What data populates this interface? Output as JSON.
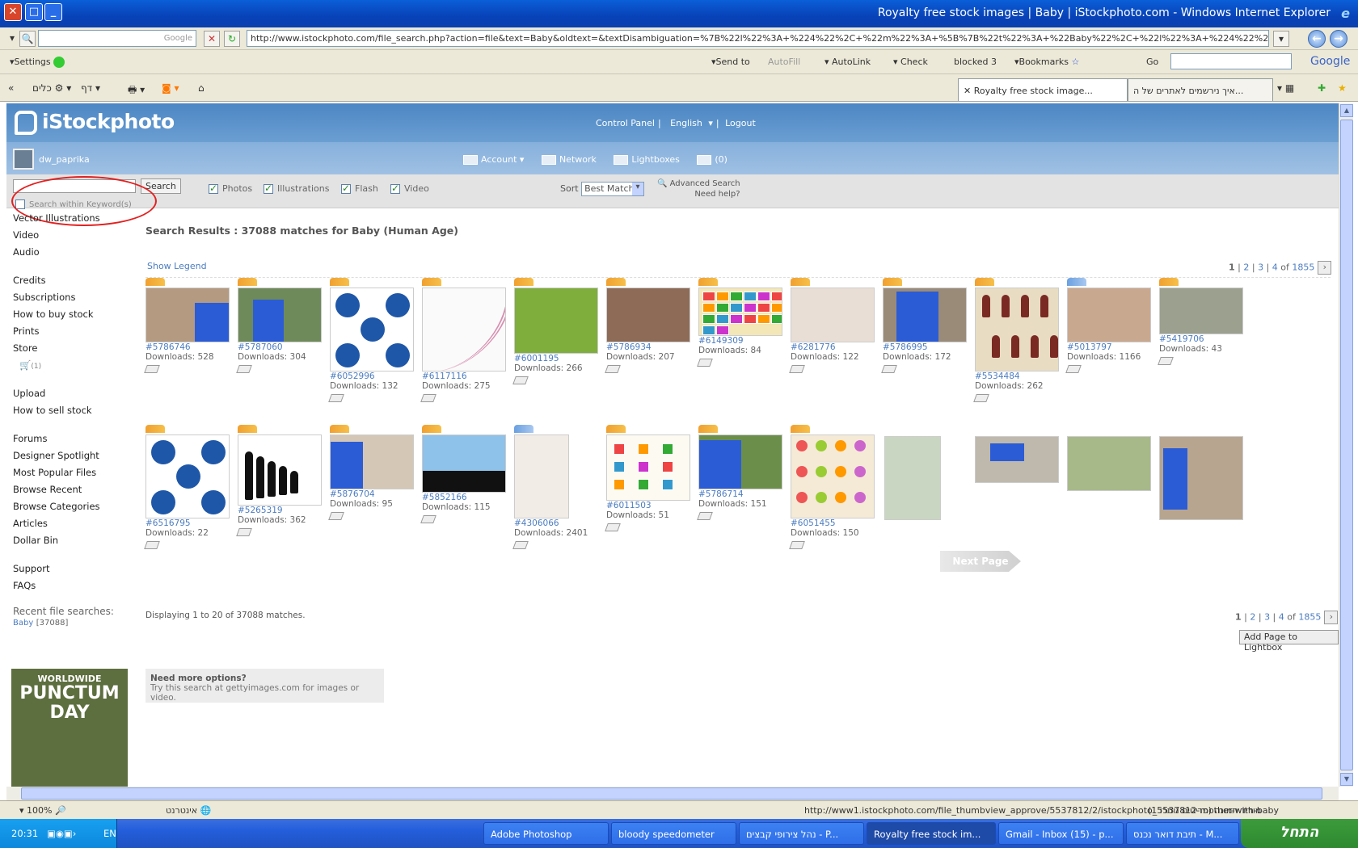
{
  "window": {
    "title": "Royalty free stock images | Baby | iStockphoto.com - Windows Internet Explorer"
  },
  "address": {
    "search_placeholder": "Google",
    "url": "http://www.istockphoto.com/file_search.php?action=file&text=Baby&oldtext=&textDisambiguation=%7B%22l%22%3A+%224%22%2C+%22m%22%3A+%5B%7B%22t%22%3A+%22Baby%22%2C+%22l%22%3A+%224%22%2C+%22c%22%3A+%"
  },
  "toolbar": {
    "settings": "Settings",
    "send_to": "Send to",
    "autofill": "AutoFill",
    "autolink": "AutoLink",
    "check": "Check",
    "blocked": "blocked 3",
    "bookmarks": "Bookmarks",
    "go": "Go",
    "google": "Google"
  },
  "tabs_row": {
    "tools": "כלים",
    "page": "דף",
    "tabs": [
      {
        "label": "Royalty free stock image...",
        "active": true
      },
      {
        "label": "איך נירשמים לאתרים של ה...",
        "active": false
      }
    ]
  },
  "site": {
    "logo": "iStockphoto",
    "header_links": [
      "Control Panel",
      "English",
      "Logout"
    ],
    "username": "dw_paprika",
    "user_links": {
      "account": "Account",
      "network": "Network",
      "lightboxes": "Lightboxes",
      "messages": "(0)"
    },
    "search_button": "Search",
    "filters": [
      "Photos",
      "Illustrations",
      "Flash",
      "Video"
    ],
    "search_within": "Search within Keyword(s)",
    "sort_label": "Sort",
    "sort_value": "Best Match",
    "advanced_search": "Advanced Search",
    "need_help": "Need help?"
  },
  "sidebar": {
    "groups": [
      [
        "Vector Illustrations",
        "Video",
        "Audio"
      ],
      [
        "Credits",
        "Subscriptions",
        "How to buy stock",
        "Prints",
        "Store"
      ],
      [
        "Upload",
        "How to sell stock"
      ],
      [
        "Forums",
        "Designer Spotlight",
        "Most Popular Files",
        "Browse Recent",
        "Browse Categories",
        "Articles",
        "Dollar Bin"
      ],
      [
        "Support",
        "FAQs"
      ]
    ],
    "cart_count": "(1)",
    "recent_title": "Recent file searches:",
    "recent_term": "Baby",
    "recent_count": "[37088]",
    "ad_line1": "WORLDWIDE",
    "ad_line2": "PUNCTUM",
    "ad_line3": "DAY"
  },
  "results": {
    "heading": "Search Results : 37088 matches for Baby (Human Age)",
    "show_legend": "Show Legend",
    "pager": {
      "current": "1",
      "pages": [
        "2",
        "3",
        "4"
      ],
      "of": "of",
      "total": "1855"
    },
    "row1": [
      {
        "id": "#5786746",
        "downloads": "Downloads: 528"
      },
      {
        "id": "#5787060",
        "downloads": "Downloads: 304"
      },
      {
        "id": "#6052996",
        "downloads": "Downloads: 132"
      },
      {
        "id": "#6117116",
        "downloads": "Downloads: 275"
      },
      {
        "id": "#6001195",
        "downloads": "Downloads: 266"
      },
      {
        "id": "#5786934",
        "downloads": "Downloads: 207"
      },
      {
        "id": "#6149309",
        "downloads": "Downloads: 84"
      },
      {
        "id": "#6281776",
        "downloads": "Downloads: 122"
      },
      {
        "id": "#5786995",
        "downloads": "Downloads: 172"
      },
      {
        "id": "#5534484",
        "downloads": "Downloads: 262"
      },
      {
        "id": "#5013797",
        "downloads": "Downloads: 1166"
      },
      {
        "id": "#5419706",
        "downloads": "Downloads: 43"
      }
    ],
    "row2": [
      {
        "id": "#6516795",
        "downloads": "Downloads: 22"
      },
      {
        "id": "#5265319",
        "downloads": "Downloads: 362"
      },
      {
        "id": "#5876704",
        "downloads": "Downloads: 95"
      },
      {
        "id": "#5852166",
        "downloads": "Downloads: 115"
      },
      {
        "id": "#4306066",
        "downloads": "Downloads: 2401"
      },
      {
        "id": "#6011503",
        "downloads": "Downloads: 51"
      },
      {
        "id": "#5786714",
        "downloads": "Downloads: 151"
      },
      {
        "id": "#6051455",
        "downloads": "Downloads: 150"
      }
    ],
    "next_page": "Next Page",
    "displaying": "Displaying 1 to 20 of 37088 matches.",
    "add_page": "Add Page to Lightbox",
    "need_more_title": "Need more options?",
    "need_more_text": "Try this search at gettyimages.com for images or video."
  },
  "statusbar": {
    "zoom": "100%",
    "zone": "אינטרנט",
    "url": "http://www1.istockphoto.com/file_thumbview_approve/5537812/2/istockphoto_5537812-mother-with-baby",
    "info": "(1 פריטים נותרו) מוריד תמונה"
  },
  "taskbar": {
    "time": "20:31",
    "lang": "EN",
    "start": "התחל",
    "tasks": [
      "Adobe Photoshop",
      "bloody speedometer",
      "נהל צירופי קבצים - P...",
      "Royalty free stock im...",
      "Gmail - Inbox (15) - p...",
      "תיבת דואר נכנס - M..."
    ]
  }
}
